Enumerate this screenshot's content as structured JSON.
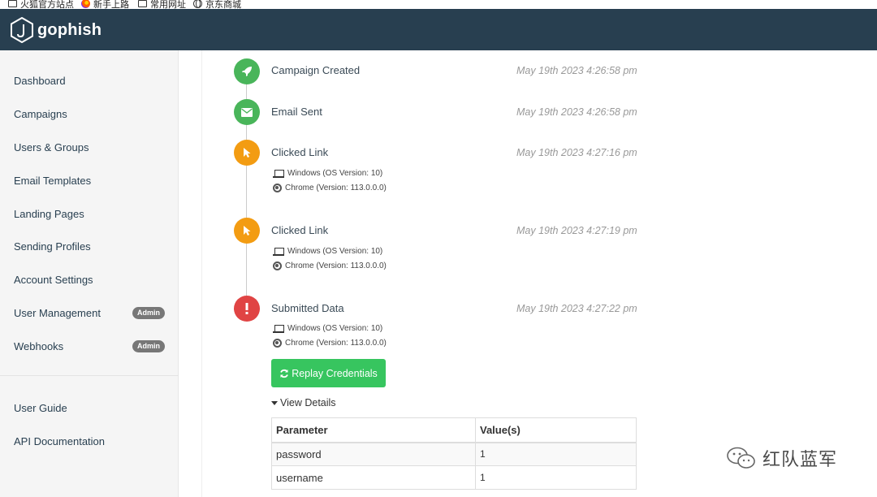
{
  "bookmarks": [
    {
      "label": "火狐官方站点",
      "icon": "folder-icon"
    },
    {
      "label": "新手上路",
      "icon": "firefox-icon"
    },
    {
      "label": "常用网址",
      "icon": "folder-icon"
    },
    {
      "label": "京东商城",
      "icon": "globe-icon"
    }
  ],
  "brand": {
    "name": "gophish"
  },
  "sidebar": {
    "items": [
      {
        "label": "Dashboard"
      },
      {
        "label": "Campaigns"
      },
      {
        "label": "Users & Groups"
      },
      {
        "label": "Email Templates"
      },
      {
        "label": "Landing Pages"
      },
      {
        "label": "Sending Profiles"
      },
      {
        "label": "Account Settings"
      },
      {
        "label": "User Management",
        "badge": "Admin"
      },
      {
        "label": "Webhooks",
        "badge": "Admin"
      }
    ],
    "footer_items": [
      {
        "label": "User Guide"
      },
      {
        "label": "API Documentation"
      }
    ]
  },
  "timeline": {
    "events": [
      {
        "title": "Campaign Created",
        "time": "May 19th 2023 4:26:58 pm",
        "icon": "rocket-icon",
        "color": "#49b55a"
      },
      {
        "title": "Email Sent",
        "time": "May 19th 2023 4:26:58 pm",
        "icon": "envelope-icon",
        "color": "#49b55a"
      },
      {
        "title": "Clicked Link",
        "time": "May 19th 2023 4:27:16 pm",
        "icon": "pointer-icon",
        "color": "#f39c12",
        "os": "Windows (OS Version: 10)",
        "browser": "Chrome (Version: 113.0.0.0)"
      },
      {
        "title": "Clicked Link",
        "time": "May 19th 2023 4:27:19 pm",
        "icon": "pointer-icon",
        "color": "#f39c12",
        "os": "Windows (OS Version: 10)",
        "browser": "Chrome (Version: 113.0.0.0)"
      },
      {
        "title": "Submitted Data",
        "time": "May 19th 2023 4:27:22 pm",
        "icon": "exclamation-icon",
        "color": "#e04444",
        "os": "Windows (OS Version: 10)",
        "browser": "Chrome (Version: 113.0.0.0)"
      }
    ]
  },
  "replay_button": {
    "label": "Replay Credentials"
  },
  "view_details": {
    "label": "View Details"
  },
  "params_table": {
    "headers": [
      "Parameter",
      "Value(s)"
    ],
    "rows": [
      [
        "password",
        "1"
      ],
      [
        "username",
        "1"
      ]
    ]
  },
  "watermark": {
    "text": "红队蓝军"
  }
}
